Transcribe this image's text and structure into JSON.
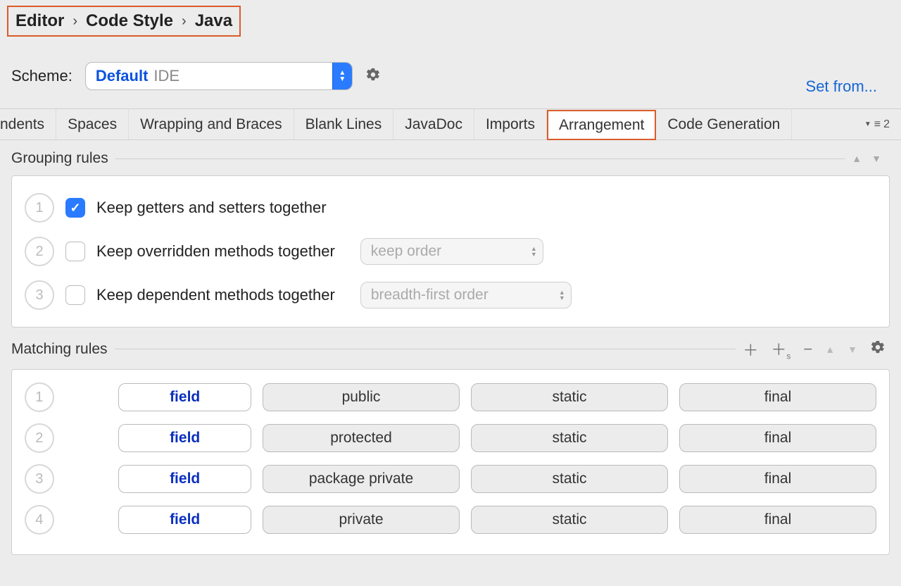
{
  "breadcrumb": {
    "a": "Editor",
    "b": "Code Style",
    "c": "Java"
  },
  "scheme": {
    "label": "Scheme:",
    "value": "Default",
    "suffix": "IDE"
  },
  "set_from": "Set from...",
  "tabs": {
    "cut": "ndents",
    "spaces": "Spaces",
    "wrap": "Wrapping and Braces",
    "blank": "Blank Lines",
    "javadoc": "JavaDoc",
    "imports": "Imports",
    "arrangement": "Arrangement",
    "codegen": "Code Generation",
    "indicator": "2"
  },
  "grouping": {
    "title": "Grouping rules",
    "rules": [
      {
        "n": "1",
        "checked": true,
        "label": "Keep getters and setters together",
        "select": null
      },
      {
        "n": "2",
        "checked": false,
        "label": "Keep overridden methods together",
        "select": "keep order"
      },
      {
        "n": "3",
        "checked": false,
        "label": "Keep dependent methods together",
        "select": "breadth-first order"
      }
    ]
  },
  "matching": {
    "title": "Matching rules",
    "rows": [
      {
        "n": "1",
        "a": "field",
        "b": "public",
        "c": "static",
        "d": "final"
      },
      {
        "n": "2",
        "a": "field",
        "b": "protected",
        "c": "static",
        "d": "final"
      },
      {
        "n": "3",
        "a": "field",
        "b": "package private",
        "c": "static",
        "d": "final"
      },
      {
        "n": "4",
        "a": "field",
        "b": "private",
        "c": "static",
        "d": "final"
      }
    ]
  }
}
